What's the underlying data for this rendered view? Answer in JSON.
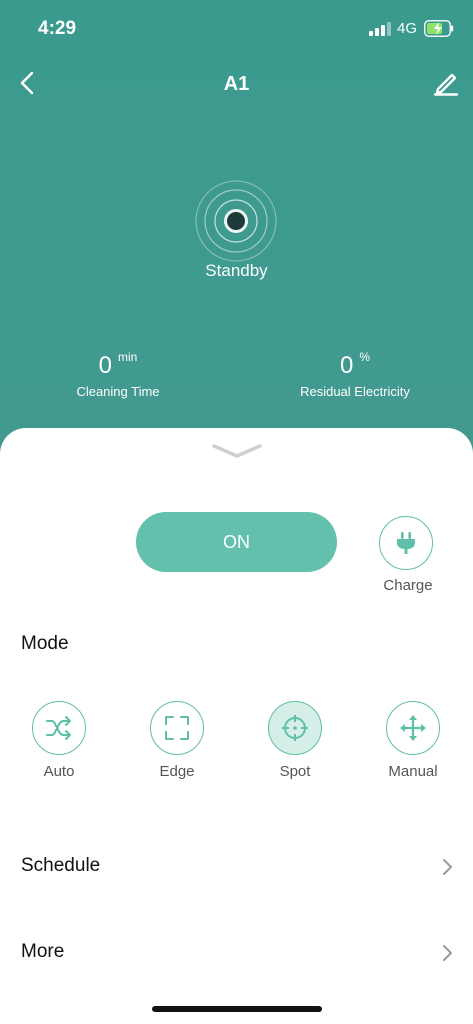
{
  "status_bar": {
    "time": "4:29",
    "network": "4G"
  },
  "nav": {
    "title": "A1"
  },
  "device": {
    "state": "Standby"
  },
  "stats": {
    "cleaning_time": {
      "value": "0",
      "unit": "min",
      "label": "Cleaning Time"
    },
    "residual": {
      "value": "0",
      "unit": "%",
      "label": "Residual Electricity"
    }
  },
  "controls": {
    "power_label": "ON",
    "charge_label": "Charge"
  },
  "mode": {
    "title": "Mode",
    "items": [
      {
        "label": "Auto",
        "icon": "shuffle-icon"
      },
      {
        "label": "Edge",
        "icon": "corners-icon"
      },
      {
        "label": "Spot",
        "icon": "crosshair-icon",
        "selected": true
      },
      {
        "label": "Manual",
        "icon": "move-arrows-icon"
      }
    ]
  },
  "rows": {
    "schedule": "Schedule",
    "more": "More"
  },
  "colors": {
    "header": "#3f9a8f",
    "accent": "#62c0ac",
    "icon": "#5fbfa9"
  }
}
